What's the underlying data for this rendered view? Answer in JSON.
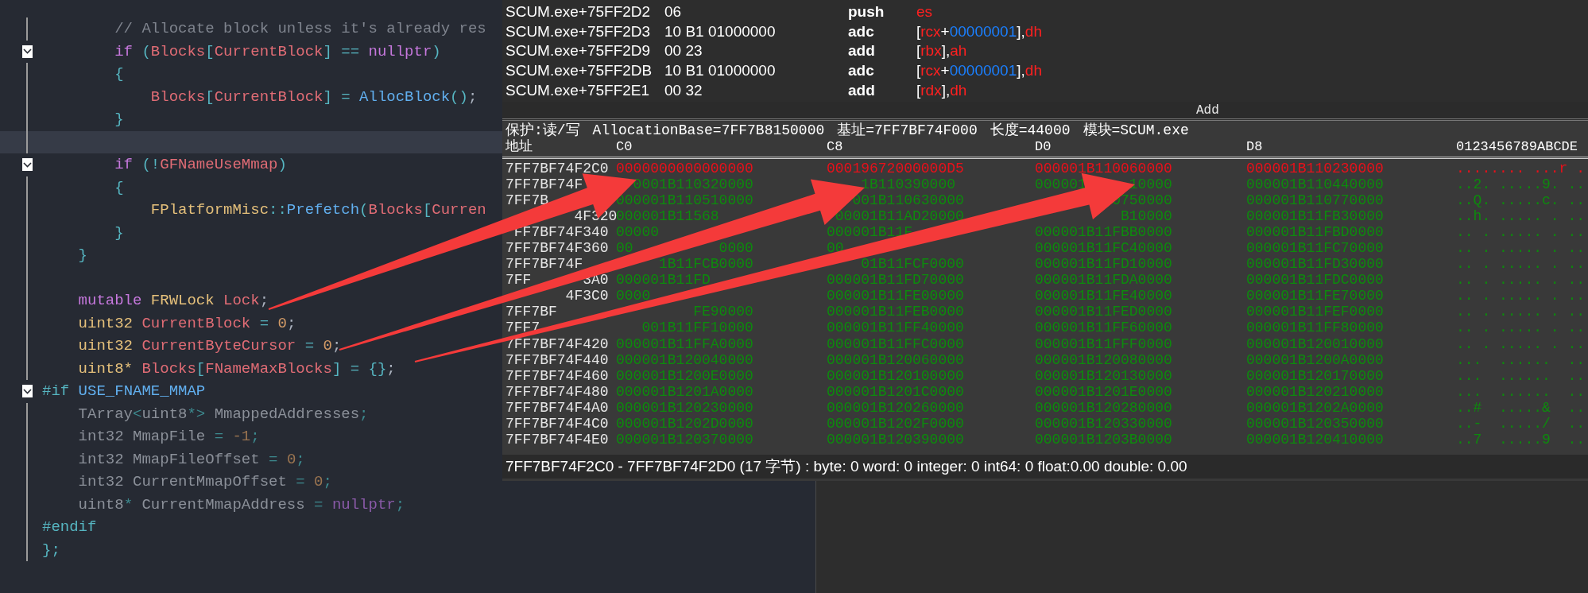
{
  "code_editor": {
    "lines": [
      {
        "collapsible": false,
        "current": false,
        "tokens": [
          {
            "text": "        // Allocate block unless it's already res",
            "kind": "cm"
          }
        ]
      },
      {
        "collapsible": true,
        "current": false,
        "tokens": [
          {
            "text": "        if",
            "kind": "kw"
          },
          {
            "text": " (",
            "kind": "pn"
          },
          {
            "text": "Blocks",
            "kind": "var"
          },
          {
            "text": "[",
            "kind": "pn"
          },
          {
            "text": "CurrentBlock",
            "kind": "var"
          },
          {
            "text": "] == ",
            "kind": "pn"
          },
          {
            "text": "nullptr",
            "kind": "kw"
          },
          {
            "text": ")",
            "kind": "pn"
          }
        ]
      },
      {
        "collapsible": false,
        "current": false,
        "tokens": [
          {
            "text": "        {",
            "kind": "pn"
          }
        ]
      },
      {
        "collapsible": false,
        "current": false,
        "tokens": [
          {
            "text": "            Blocks",
            "kind": "var"
          },
          {
            "text": "[",
            "kind": "pn"
          },
          {
            "text": "CurrentBlock",
            "kind": "var"
          },
          {
            "text": "] = ",
            "kind": "pn"
          },
          {
            "text": "AllocBlock",
            "kind": "fn"
          },
          {
            "text": "()",
            "kind": "pn"
          },
          {
            "text": ";",
            "kind": "pl"
          }
        ]
      },
      {
        "collapsible": false,
        "current": false,
        "tokens": [
          {
            "text": "        }",
            "kind": "pn"
          }
        ]
      },
      {
        "collapsible": false,
        "current": true
      },
      {
        "collapsible": true,
        "current": false,
        "tokens": [
          {
            "text": "        if",
            "kind": "kw"
          },
          {
            "text": " (!",
            "kind": "pn"
          },
          {
            "text": "GFNameUseMmap",
            "kind": "var"
          },
          {
            "text": ")",
            "kind": "pn"
          }
        ]
      },
      {
        "collapsible": false,
        "current": false,
        "tokens": [
          {
            "text": "        {",
            "kind": "pn"
          }
        ]
      },
      {
        "collapsible": false,
        "current": false,
        "tokens": [
          {
            "text": "            FPlatformMisc",
            "kind": "type"
          },
          {
            "text": "::",
            "kind": "pn"
          },
          {
            "text": "Prefetch",
            "kind": "fn"
          },
          {
            "text": "(",
            "kind": "pn"
          },
          {
            "text": "Blocks",
            "kind": "var"
          },
          {
            "text": "[",
            "kind": "pn"
          },
          {
            "text": "Curren",
            "kind": "var"
          }
        ]
      },
      {
        "collapsible": false,
        "current": false,
        "tokens": [
          {
            "text": "        }",
            "kind": "pn"
          }
        ]
      },
      {
        "collapsible": false,
        "current": false,
        "tokens": [
          {
            "text": "    }",
            "kind": "pn"
          }
        ]
      },
      {
        "collapsible": false,
        "current": false
      },
      {
        "collapsible": false,
        "current": false,
        "tokens": [
          {
            "text": "    mutable",
            "kind": "kw"
          },
          {
            "text": " FRWLock",
            "kind": "type"
          },
          {
            "text": " Lock",
            "kind": "var"
          },
          {
            "text": ";",
            "kind": "pl"
          }
        ]
      },
      {
        "collapsible": false,
        "current": false,
        "tokens": [
          {
            "text": "    uint32",
            "kind": "type"
          },
          {
            "text": " CurrentBlock",
            "kind": "var"
          },
          {
            "text": " = ",
            "kind": "pn"
          },
          {
            "text": "0",
            "kind": "num"
          },
          {
            "text": ";",
            "kind": "pl"
          }
        ]
      },
      {
        "collapsible": false,
        "current": false,
        "tokens": [
          {
            "text": "    uint32",
            "kind": "type"
          },
          {
            "text": " CurrentByteCursor",
            "kind": "var"
          },
          {
            "text": " = ",
            "kind": "pn"
          },
          {
            "text": "0",
            "kind": "num"
          },
          {
            "text": ";",
            "kind": "pl"
          }
        ]
      },
      {
        "collapsible": false,
        "current": false,
        "tokens": [
          {
            "text": "    uint8*",
            "kind": "type"
          },
          {
            "text": " Blocks",
            "kind": "var"
          },
          {
            "text": "[",
            "kind": "pn"
          },
          {
            "text": "FNameMaxBlocks",
            "kind": "var"
          },
          {
            "text": "] = {}",
            "kind": "pn"
          },
          {
            "text": ";",
            "kind": "pl"
          }
        ]
      },
      {
        "collapsible": true,
        "current": false,
        "tokens": [
          {
            "text": "#if",
            "kind": "pp"
          },
          {
            "text": " USE_FNAME_MMAP",
            "kind": "fn"
          }
        ]
      },
      {
        "collapsible": false,
        "current": false,
        "tokens": [
          {
            "text": "    TArray",
            "kind": "dim"
          },
          {
            "text": "<",
            "kind": "dpn"
          },
          {
            "text": "uint8",
            "kind": "dim"
          },
          {
            "text": "*>",
            "kind": "dpn"
          },
          {
            "text": " MmappedAddresses",
            "kind": "dim"
          },
          {
            "text": ";",
            "kind": "dpn"
          }
        ]
      },
      {
        "collapsible": false,
        "current": false,
        "tokens": [
          {
            "text": "    int32 MmapFile",
            "kind": "dim"
          },
          {
            "text": " = ",
            "kind": "dpn"
          },
          {
            "text": "-1",
            "kind": "dnum"
          },
          {
            "text": ";",
            "kind": "dpn"
          }
        ]
      },
      {
        "collapsible": false,
        "current": false,
        "tokens": [
          {
            "text": "    int32 MmapFileOffset",
            "kind": "dim"
          },
          {
            "text": " = ",
            "kind": "dpn"
          },
          {
            "text": "0",
            "kind": "dnum"
          },
          {
            "text": ";",
            "kind": "dpn"
          }
        ]
      },
      {
        "collapsible": false,
        "current": false,
        "tokens": [
          {
            "text": "    int32 CurrentMmapOffset",
            "kind": "dim"
          },
          {
            "text": " = ",
            "kind": "dpn"
          },
          {
            "text": "0",
            "kind": "dnum"
          },
          {
            "text": ";",
            "kind": "dpn"
          }
        ]
      },
      {
        "collapsible": false,
        "current": false,
        "tokens": [
          {
            "text": "    uint8",
            "kind": "dim"
          },
          {
            "text": "*",
            "kind": "dpn"
          },
          {
            "text": " CurrentMmapAddress",
            "kind": "dim"
          },
          {
            "text": " = ",
            "kind": "dpn"
          },
          {
            "text": "nullptr",
            "kind": "dkw"
          },
          {
            "text": ";",
            "kind": "dpn"
          }
        ]
      },
      {
        "collapsible": false,
        "current": false,
        "tokens": [
          {
            "text": "#endif",
            "kind": "pp"
          }
        ]
      },
      {
        "collapsible": false,
        "current": false,
        "tokens": [
          {
            "text": "};",
            "kind": "pn"
          }
        ]
      }
    ]
  },
  "disassembly": {
    "rows": [
      {
        "address": "SCUM.exe+75FF2D2",
        "bytes": "06",
        "mnemonic": "push",
        "operands": [
          {
            "text": "es",
            "kind": "reg"
          }
        ]
      },
      {
        "address": "SCUM.exe+75FF2D3",
        "bytes": "10 B1 01000000",
        "mnemonic": "adc",
        "operands": [
          {
            "text": "[",
            "kind": "p"
          },
          {
            "text": "rcx",
            "kind": "reg"
          },
          {
            "text": "+",
            "kind": "p"
          },
          {
            "text": "00000001",
            "kind": "num"
          },
          {
            "text": "],",
            "kind": "p"
          },
          {
            "text": "dh",
            "kind": "reg"
          }
        ]
      },
      {
        "address": "SCUM.exe+75FF2D9",
        "bytes": "00 23",
        "mnemonic": "add",
        "operands": [
          {
            "text": "[",
            "kind": "p"
          },
          {
            "text": "rbx",
            "kind": "reg"
          },
          {
            "text": "],",
            "kind": "p"
          },
          {
            "text": "ah",
            "kind": "reg"
          }
        ]
      },
      {
        "address": "SCUM.exe+75FF2DB",
        "bytes": "10 B1 01000000",
        "mnemonic": "adc",
        "operands": [
          {
            "text": "[",
            "kind": "p"
          },
          {
            "text": "rcx",
            "kind": "reg"
          },
          {
            "text": "+",
            "kind": "p"
          },
          {
            "text": "00000001",
            "kind": "num"
          },
          {
            "text": "],",
            "kind": "p"
          },
          {
            "text": "dh",
            "kind": "reg"
          }
        ]
      },
      {
        "address": "SCUM.exe+75FF2E1",
        "bytes": "00 32",
        "mnemonic": "add",
        "operands": [
          {
            "text": "[",
            "kind": "p"
          },
          {
            "text": "rdx",
            "kind": "reg"
          },
          {
            "text": "],",
            "kind": "p"
          },
          {
            "text": "dh",
            "kind": "reg"
          }
        ]
      }
    ]
  },
  "memory_view": {
    "title": "Add",
    "info": [
      "保护:读/写",
      "AllocationBase=7FF7B8150000",
      "基址=7FF7BF74F000",
      "长度=44000",
      "模块=SCUM.exe"
    ],
    "columns": [
      "地址",
      "C0",
      "C8",
      "D0",
      "D8",
      "0123456789ABCDE"
    ],
    "rows": [
      {
        "changed": true,
        "cells": [
          "7FF7BF74F2C0",
          "0000000000000000",
          "00019672000000D5",
          "000001B110060000",
          "000001B110230000",
          "........ ...r ."
        ]
      },
      {
        "changed": false,
        "cells": [
          "7FF7BF74F",
          "  0001B110320000",
          "    1B110390000",
          "000001     10000",
          "000001B110440000",
          "..2. .....9. .."
        ]
      },
      {
        "changed": false,
        "cells": [
          "7FF7B",
          "000001B110510000",
          "   001B110630000",
          "         0750000",
          "000001B110770000",
          "..Q. .....c. .."
        ]
      },
      {
        "changed": false,
        "cells": [
          "        4F320",
          "000001B11568",
          " 00001B11AD20000",
          "          B10000",
          "000001B11FB30000",
          "..h. ..... . .."
        ]
      },
      {
        "changed": false,
        "cells": [
          " FF7BF74F340",
          "00000",
          "000001B11F",
          "000001B11FBB0000",
          "000001B11FBD0000",
          ".. . ..... . .."
        ]
      },
      {
        "changed": false,
        "cells": [
          "7FF7BF74F360",
          "00          0000",
          "00",
          "000001B11FC40000",
          "000001B11FC70000",
          ".. . ..... . .."
        ]
      },
      {
        "changed": false,
        "cells": [
          "7FF7BF74F",
          "     1B11FCB0000",
          "    01B11FCF0000",
          "000001B11FD10000",
          "000001B11FD30000",
          ".. . ..... . .."
        ]
      },
      {
        "changed": false,
        "cells": [
          "7FF      3A0",
          "000001B11FD",
          "000001B11FD70000",
          "000001B11FDA0000",
          "000001B11FDC0000",
          ".. . ..... . .."
        ]
      },
      {
        "changed": false,
        "cells": [
          "       4F3C0",
          "0000",
          "000001B11FE00000",
          "000001B11FE40000",
          "000001B11FE70000",
          ".. . ..... . .."
        ]
      },
      {
        "changed": false,
        "cells": [
          "7FF7BF",
          "         FE90000",
          "000001B11FEB0000",
          "000001B11FED0000",
          "000001B11FEF0000",
          ".. . ..... . .."
        ]
      },
      {
        "changed": false,
        "cells": [
          "7FF7",
          "   001B11FF10000",
          "000001B11FF40000",
          "000001B11FF60000",
          "000001B11FF80000",
          ".. . ..... . .."
        ]
      },
      {
        "changed": false,
        "cells": [
          "7FF7BF74F420",
          "000001B11FFA0000",
          "000001B11FFC0000",
          "000001B11FFF0000",
          "000001B120010000",
          ".. . ..... . .."
        ]
      },
      {
        "changed": false,
        "cells": [
          "7FF7BF74F440",
          "000001B120040000",
          "000001B120060000",
          "000001B120080000",
          "000001B1200A0000",
          "...  ......  .."
        ]
      },
      {
        "changed": false,
        "cells": [
          "7FF7BF74F460",
          "000001B1200E0000",
          "000001B120100000",
          "000001B120130000",
          "000001B120170000",
          "...  ......  .."
        ]
      },
      {
        "changed": false,
        "cells": [
          "7FF7BF74F480",
          "000001B1201A0000",
          "000001B1201C0000",
          "000001B1201E0000",
          "000001B120210000",
          "...  ......  .."
        ]
      },
      {
        "changed": false,
        "cells": [
          "7FF7BF74F4A0",
          "000001B120230000",
          "000001B120260000",
          "000001B120280000",
          "000001B1202A0000",
          "..#  .....&  .."
        ]
      },
      {
        "changed": false,
        "cells": [
          "7FF7BF74F4C0",
          "000001B1202D0000",
          "000001B1202F0000",
          "000001B120330000",
          "000001B120350000",
          "..-  ...../  .."
        ]
      },
      {
        "changed": false,
        "cells": [
          "7FF7BF74F4E0",
          "000001B120370000",
          "000001B120390000",
          "000001B1203B0000",
          "000001B120410000",
          "..7  .....9  .."
        ]
      }
    ],
    "status": "7FF7BF74F2C0 - 7FF7BF74F2D0 (17 字节) : byte: 0 word: 0 integer: 0 int64: 0 float:0.00 double: 0.00"
  }
}
